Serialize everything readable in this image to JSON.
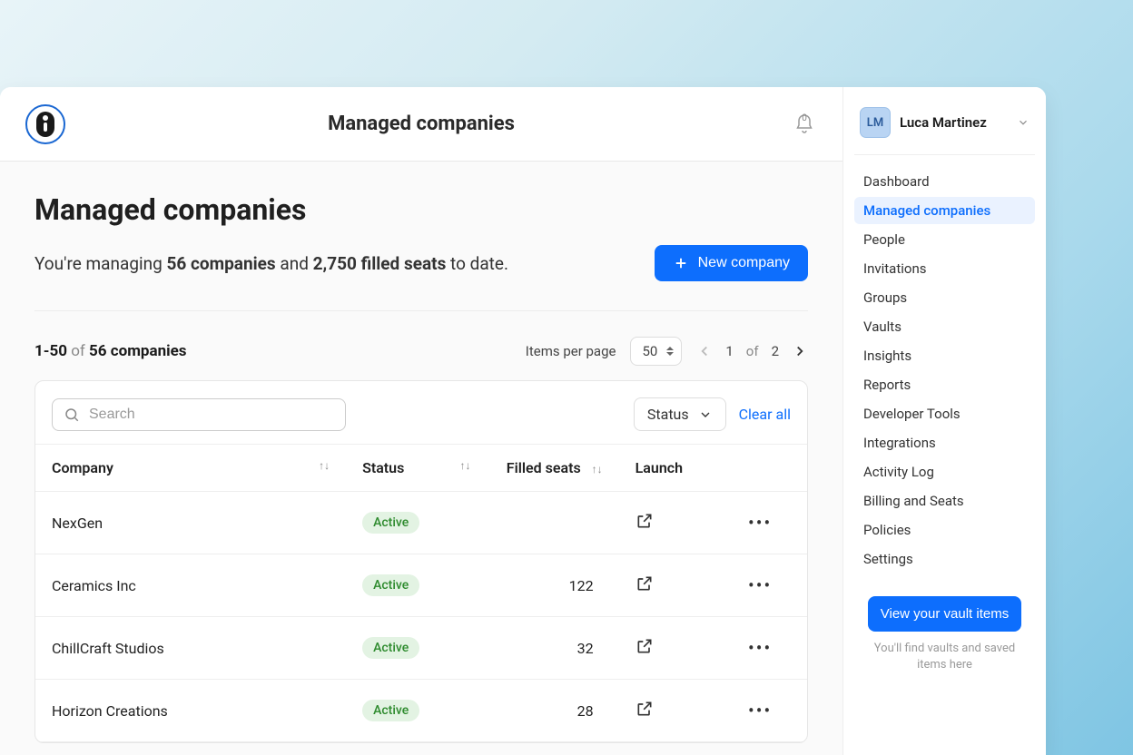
{
  "header": {
    "title": "Managed companies",
    "notification_count": "0"
  },
  "page": {
    "title": "Managed companies",
    "summary_prefix": "You're managing ",
    "company_count": "56 companies",
    "summary_mid": " and ",
    "seat_count": "2,750 filled seats",
    "summary_suffix": " to date.",
    "new_company_label": "New company"
  },
  "pagination": {
    "range": "1-50",
    "of_label": "of",
    "total_label": "56 companies",
    "items_per_page_label": "Items per page",
    "per_page_value": "50",
    "current_page": "1",
    "page_of": "of",
    "total_pages": "2"
  },
  "toolbar": {
    "search_placeholder": "Search",
    "status_filter_label": "Status",
    "clear_label": "Clear all"
  },
  "columns": {
    "company": "Company",
    "status": "Status",
    "filled": "Filled seats",
    "launch": "Launch"
  },
  "rows": [
    {
      "company": "NexGen",
      "status": "Active",
      "filled": ""
    },
    {
      "company": "Ceramics Inc",
      "status": "Active",
      "filled": "122"
    },
    {
      "company": "ChillCraft Studios",
      "status": "Active",
      "filled": "32"
    },
    {
      "company": "Horizon Creations",
      "status": "Active",
      "filled": "28"
    }
  ],
  "user": {
    "initials": "LM",
    "name": "Luca Martinez"
  },
  "nav": [
    {
      "label": "Dashboard",
      "active": false
    },
    {
      "label": "Managed companies",
      "active": true
    },
    {
      "label": "People",
      "active": false
    },
    {
      "label": "Invitations",
      "active": false
    },
    {
      "label": "Groups",
      "active": false
    },
    {
      "label": "Vaults",
      "active": false
    },
    {
      "label": "Insights",
      "active": false
    },
    {
      "label": "Reports",
      "active": false
    },
    {
      "label": "Developer Tools",
      "active": false
    },
    {
      "label": "Integrations",
      "active": false
    },
    {
      "label": "Activity Log",
      "active": false
    },
    {
      "label": "Billing and Seats",
      "active": false
    },
    {
      "label": "Policies",
      "active": false
    },
    {
      "label": "Settings",
      "active": false
    }
  ],
  "vault": {
    "button": "View your vault items",
    "hint": "You'll find vaults and saved items here"
  }
}
